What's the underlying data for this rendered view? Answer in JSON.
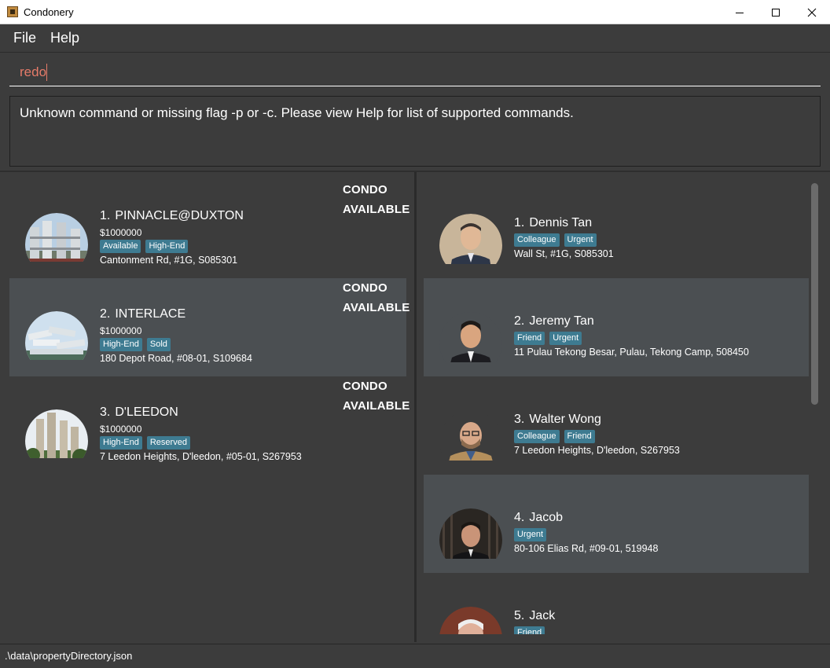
{
  "window": {
    "title": "Condonery"
  },
  "menu": {
    "file_label": "File",
    "help_label": "Help"
  },
  "command_box": {
    "value": "redo"
  },
  "result_display": {
    "message": "Unknown command or missing flag -p or -c. Please view Help for list of supported commands."
  },
  "properties": [
    {
      "index": "1.",
      "name": "PINNACLE@DUXTON",
      "price": "$1000000",
      "tags": [
        "Available",
        "High-End"
      ],
      "address": "Cantonment Rd, #1G, S085301",
      "type": "CONDO",
      "status": "AVAILABLE"
    },
    {
      "index": "2.",
      "name": "INTERLACE",
      "price": "$1000000",
      "tags": [
        "High-End",
        "Sold"
      ],
      "address": "180 Depot Road, #08-01, S109684",
      "type": "CONDO",
      "status": "AVAILABLE"
    },
    {
      "index": "3.",
      "name": "D'LEEDON",
      "price": "$1000000",
      "tags": [
        "High-End",
        "Reserved"
      ],
      "address": "7 Leedon Heights, D'leedon, #05-01, S267953",
      "type": "CONDO",
      "status": "AVAILABLE"
    }
  ],
  "clients": [
    {
      "index": "1.",
      "name": "Dennis Tan",
      "tags": [
        "Colleague",
        "Urgent"
      ],
      "address": "Wall St, #1G, S085301"
    },
    {
      "index": "2.",
      "name": "Jeremy Tan",
      "tags": [
        "Friend",
        "Urgent"
      ],
      "address": "11 Pulau Tekong Besar, Pulau, Tekong Camp, 508450"
    },
    {
      "index": "3.",
      "name": "Walter Wong",
      "tags": [
        "Colleague",
        "Friend"
      ],
      "address": "7 Leedon Heights, D'leedon, S267953"
    },
    {
      "index": "4.",
      "name": "Jacob",
      "tags": [
        "Urgent"
      ],
      "address": "80-106 Elias Rd, #09-01, 519948"
    },
    {
      "index": "5.",
      "name": "Jack",
      "tags": [
        "Friend"
      ],
      "address": ""
    }
  ],
  "status_bar": {
    "path": ".\\data\\propertyDirectory.json"
  },
  "colors": {
    "background": "#3c3c3c",
    "alt_card": "#4b4f52",
    "tag": "#3e7b91",
    "command_text": "#e67b69"
  }
}
